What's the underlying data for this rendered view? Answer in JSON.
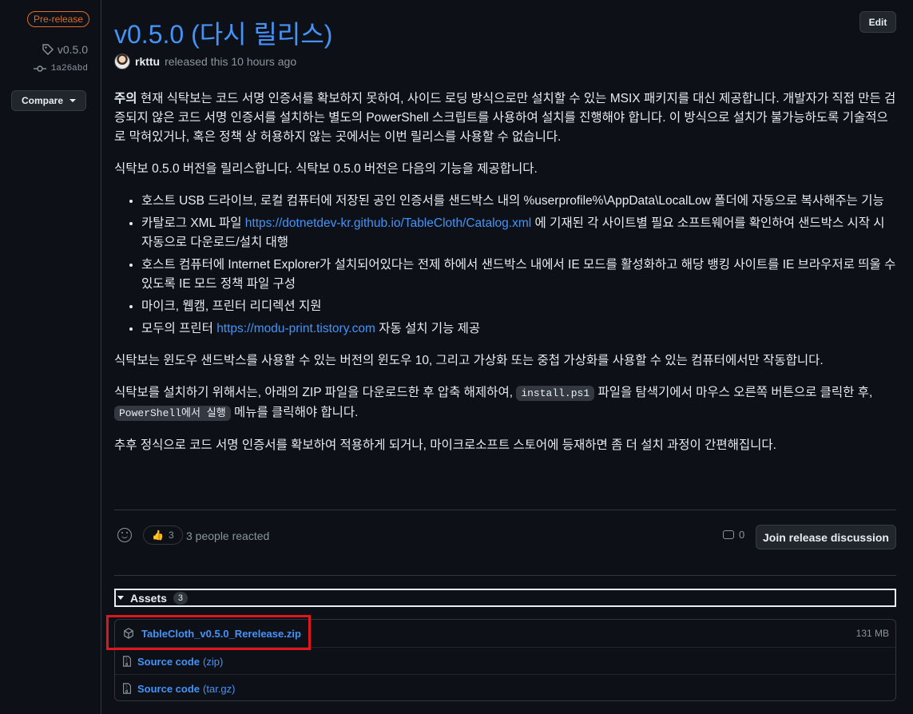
{
  "sidebar": {
    "badge": "Pre-release",
    "tag": "v0.5.0",
    "commit": "1a26abd",
    "compare_label": "Compare"
  },
  "release": {
    "title": "v0.5.0 (다시 릴리스)",
    "edit_label": "Edit",
    "author": "rkttu",
    "released_text": "released this 10 hours ago"
  },
  "body": {
    "notice_bold": "주의",
    "notice_text": " 현재 식탁보는 코드 서명 인증서를 확보하지 못하여, 사이드 로딩 방식으로만 설치할 수 있는 MSIX 패키지를 대신 제공합니다. 개발자가 직접 만든 검증되지 않은 코드 서명 인증서를 설치하는 별도의 PowerShell 스크립트를 사용하여 설치를 진행해야 합니다. 이 방식으로 설치가 불가능하도록 기술적으로 막혀있거나, 혹은 정책 상 허용하지 않는 곳에서는 이번 릴리스를 사용할 수 없습니다.",
    "intro": "식탁보 0.5.0 버전을 릴리스합니다. 식탁보 0.5.0 버전은 다음의 기능을 제공합니다.",
    "features": {
      "f1": "호스트 USB 드라이브, 로컬 컴퓨터에 저장된 공인 인증서를 샌드박스 내의 %userprofile%\\AppData\\LocalLow 폴더에 자동으로 복사해주는 기능",
      "f2_pre": "카탈로그 XML 파일 ",
      "f2_link": "https://dotnetdev-kr.github.io/TableCloth/Catalog.xml",
      "f2_post": " 에 기재된 각 사이트별 필요 소프트웨어를 확인하여 샌드박스 시작 시 자동으로 다운로드/설치 대행",
      "f3": "호스트 컴퓨터에 Internet Explorer가 설치되어있다는 전제 하에서 샌드박스 내에서 IE 모드를 활성화하고 해당 뱅킹 사이트를 IE 브라우저로 띄울 수 있도록 IE 모드 정책 파일 구성",
      "f4": "마이크, 웹캠, 프린터 리디렉션 지원",
      "f5_pre": "모두의 프린터 ",
      "f5_link": "https://modu-print.tistory.com",
      "f5_post": " 자동 설치 기능 제공"
    },
    "requirements": "식탁보는 윈도우 샌드박스를 사용할 수 있는 버전의 윈도우 10, 그리고 가상화 또는 중첩 가상화를 사용할 수 있는 컴퓨터에서만 작동합니다.",
    "install_pre": "식탁보를 설치하기 위해서는, 아래의 ZIP 파일을 다운로드한 후 압축 해제하여, ",
    "install_code1": "install.ps1",
    "install_mid": " 파일을 탐색기에서 마우스 오른쪽 버튼으로 클릭한 후, ",
    "install_code2": "PowerShell에서 실행",
    "install_post": " 메뉴를 클릭해야 합니다.",
    "future": "추후 정식으로 코드 서명 인증서를 확보하여 적용하게 되거나, 마이크로소프트 스토어에 등재하면 좀 더 설치 과정이 간편해집니다."
  },
  "reactions": {
    "thumbs_emoji": "👍",
    "thumbs_count": "3",
    "summary": "3 people reacted",
    "comment_count": "0",
    "join_label": "Join release discussion"
  },
  "assets": {
    "title": "Assets",
    "count": "3",
    "items": [
      {
        "name": "TableCloth_v0.5.0_Rerelease.zip",
        "size": "131 MB"
      },
      {
        "name": "Source code",
        "sub": "(zip)"
      },
      {
        "name": "Source code",
        "sub": "(tar.gz)"
      }
    ]
  }
}
